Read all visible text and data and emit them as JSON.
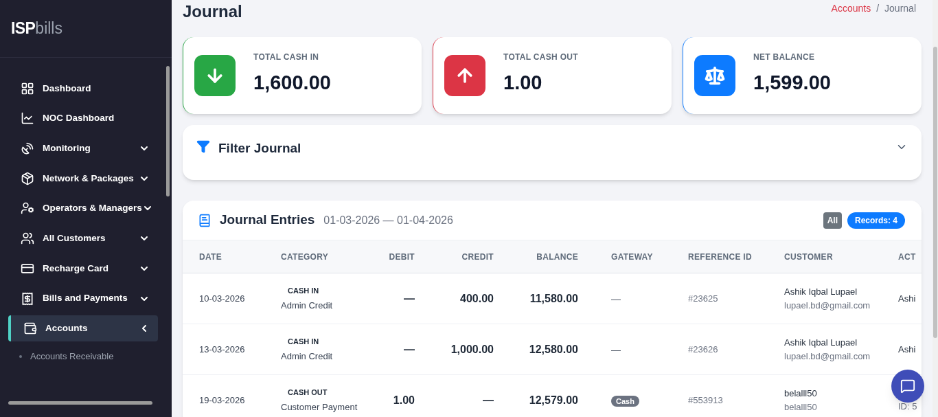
{
  "sidebar": {
    "logo": {
      "bold": "ISP",
      "light": "bills"
    },
    "items": [
      {
        "label": "Dashboard",
        "kind": "link",
        "selected": false
      },
      {
        "label": "NOC Dashboard",
        "kind": "link",
        "selected": false
      },
      {
        "label": "Monitoring",
        "kind": "menu",
        "expanded": false,
        "selected": false
      },
      {
        "label": "Network & Packages",
        "kind": "menu",
        "expanded": false,
        "selected": false
      },
      {
        "label": "Operators & Managers",
        "kind": "menu",
        "expanded": false,
        "selected": false
      },
      {
        "label": "All Customers",
        "kind": "menu",
        "expanded": false,
        "selected": false
      },
      {
        "label": "Recharge Card",
        "kind": "menu",
        "expanded": false,
        "selected": false
      },
      {
        "label": "Bills and Payments",
        "kind": "menu",
        "expanded": false,
        "selected": false
      },
      {
        "label": "Accounts",
        "kind": "menu",
        "expanded": true,
        "selected": true,
        "children": [
          {
            "label": "Accounts Receivable"
          }
        ]
      }
    ]
  },
  "page": {
    "title": "Journal",
    "breadcrumb": [
      {
        "label": "Accounts",
        "kind": "link"
      },
      {
        "label": "/",
        "kind": "separator"
      },
      {
        "label": "Journal",
        "kind": "current"
      }
    ]
  },
  "stats": [
    {
      "label": "TOTAL CASH IN",
      "value": "1,600.00",
      "color": "#28a745"
    },
    {
      "label": "TOTAL CASH OUT",
      "value": "1.00",
      "color": "#dc3545"
    },
    {
      "label": "NET BALANCE",
      "value": "1,599.00",
      "color": "#0d7bff"
    }
  ],
  "filter": {
    "title": "Filter Journal",
    "expanded": false
  },
  "journal": {
    "title": "Journal Entries",
    "range": "01-03-2026 — 01-04-2026",
    "badges": [
      {
        "label": "All",
        "color": "#6c757d"
      },
      {
        "label": "Records: 4",
        "color": "#0d7bff"
      }
    ],
    "columns": [
      "DATE",
      "CATEGORY",
      "DEBIT",
      "CREDIT",
      "BALANCE",
      "GATEWAY",
      "REFERENCE ID",
      "CUSTOMER",
      "ACT"
    ],
    "rows": [
      {
        "date": "10-03-2026",
        "category": "CASH IN",
        "subcategory": "Admin Credit",
        "debit": "—",
        "credit": "400.00",
        "balance": "11,580.00",
        "gateway": {
          "kind": "none",
          "text": "—"
        },
        "reference": "#23625",
        "customer": "Ashik Iqbal Lupael",
        "customer_email": "lupael.bd@gmail.com",
        "actor": "Ashi"
      },
      {
        "date": "13-03-2026",
        "category": "CASH IN",
        "subcategory": "Admin Credit",
        "debit": "—",
        "credit": "1,000.00",
        "balance": "12,580.00",
        "gateway": {
          "kind": "none",
          "text": "—"
        },
        "reference": "#23626",
        "customer": "Ashik Iqbal Lupael",
        "customer_email": "lupael.bd@gmail.com",
        "actor": "Ashi"
      },
      {
        "date": "19-03-2026",
        "category": "CASH OUT",
        "subcategory": "Customer Payment",
        "debit": "1.00",
        "credit": "—",
        "balance": "12,579.00",
        "gateway": {
          "kind": "badge",
          "text": "Cash"
        },
        "reference": "#553913",
        "customer": "belalll50",
        "customer_email": "belalll50",
        "actor_id": "ID: 5"
      }
    ]
  }
}
